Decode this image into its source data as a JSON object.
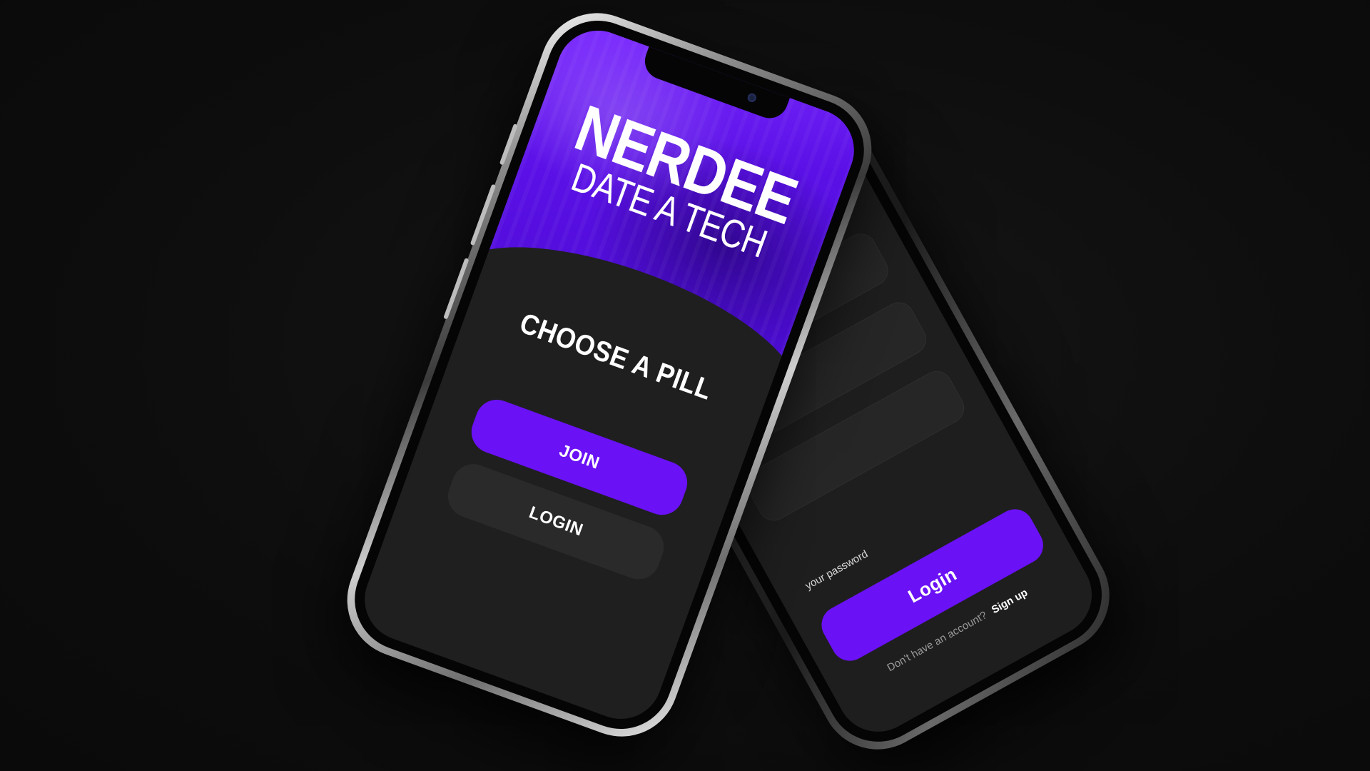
{
  "colors": {
    "background": "#0d0d0d",
    "accent": "#6a11f5",
    "screen_dark": "#1f1f1f",
    "button_dark": "#2a2a2a"
  },
  "front_phone": {
    "brand_title": "NERDEE",
    "brand_tagline": "DATE A TECH",
    "heading": "CHOOSE A PILL",
    "join_label": "JOIN",
    "login_label": "LOGIN"
  },
  "back_phone": {
    "password_label": "your password",
    "login_button": "Login",
    "signup_prompt": "Don't have an account?",
    "signup_link": "Sign up"
  }
}
